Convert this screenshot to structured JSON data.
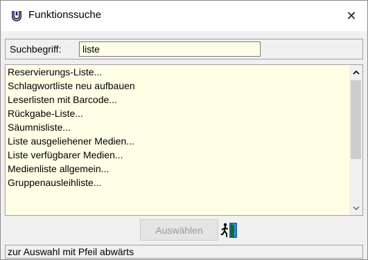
{
  "window": {
    "title": "Funktionssuche",
    "icon": "library-app-icon",
    "close_icon": "close-icon",
    "close_glyph": "✕"
  },
  "search": {
    "label": "Suchbegriff:",
    "value": "liste"
  },
  "results": {
    "items": [
      "Reservierungs-Liste...",
      "Schlagwortliste neu aufbauen",
      "Leserlisten mit Barcode...",
      "Rückgabe-Liste...",
      "Säumnisliste...",
      "Liste ausgeliehener Medien...",
      "Liste verfügbarer Medien...",
      "Medienliste allgemein...",
      "Gruppenausleihliste..."
    ],
    "scrollbar": {
      "up_icon": "chevron-up-icon",
      "down_icon": "chevron-down-icon"
    }
  },
  "actions": {
    "select_label": "Auswählen",
    "select_enabled": false,
    "exit_icon": "exit-door-icon"
  },
  "status": {
    "text": "zur Auswahl mit Pfeil abwärts"
  },
  "colors": {
    "list_background": "#ffffe6",
    "input_background": "#ffffe8",
    "window_background": "#f0f0f0",
    "disabled_text": "#9a9a9a"
  }
}
